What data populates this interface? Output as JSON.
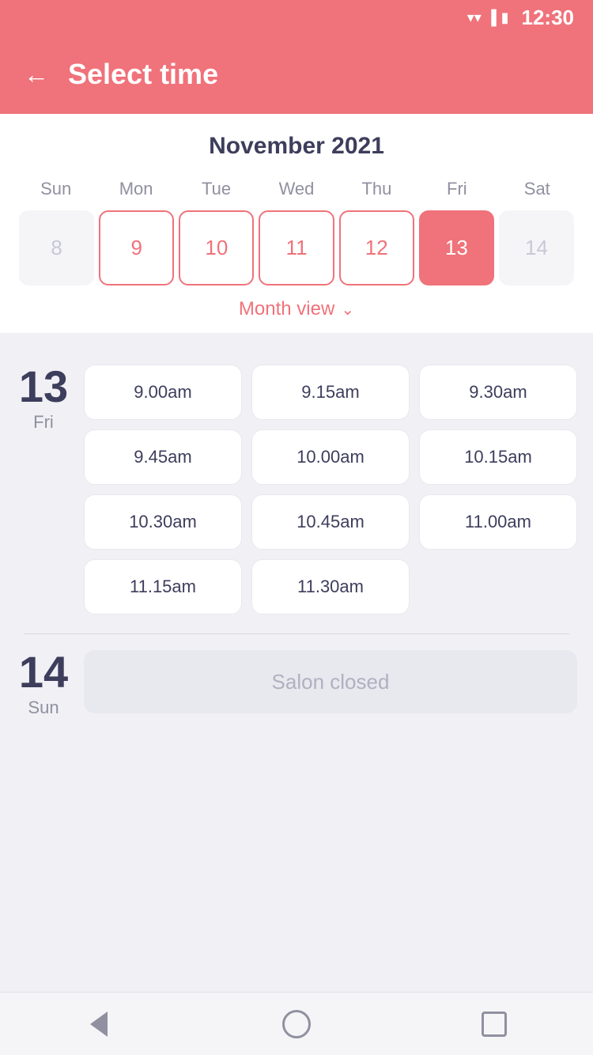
{
  "statusBar": {
    "time": "12:30"
  },
  "header": {
    "backLabel": "←",
    "title": "Select time"
  },
  "calendar": {
    "monthYear": "November 2021",
    "dayHeaders": [
      "Sun",
      "Mon",
      "Tue",
      "Wed",
      "Thu",
      "Fri",
      "Sat"
    ],
    "weekDays": [
      {
        "number": "8",
        "state": "inactive"
      },
      {
        "number": "9",
        "state": "available"
      },
      {
        "number": "10",
        "state": "available"
      },
      {
        "number": "11",
        "state": "available"
      },
      {
        "number": "12",
        "state": "available"
      },
      {
        "number": "13",
        "state": "selected"
      },
      {
        "number": "14",
        "state": "inactive"
      }
    ],
    "monthViewLabel": "Month view",
    "monthViewChevron": "⌄"
  },
  "dayBlocks": [
    {
      "number": "13",
      "name": "Fri",
      "slots": [
        "9.00am",
        "9.15am",
        "9.30am",
        "9.45am",
        "10.00am",
        "10.15am",
        "10.30am",
        "10.45am",
        "11.00am",
        "11.15am",
        "11.30am"
      ],
      "closed": false
    },
    {
      "number": "14",
      "name": "Sun",
      "slots": [],
      "closed": true,
      "closedText": "Salon closed"
    }
  ],
  "navBar": {
    "backLabel": "back",
    "homeLabel": "home",
    "recentsLabel": "recents"
  }
}
